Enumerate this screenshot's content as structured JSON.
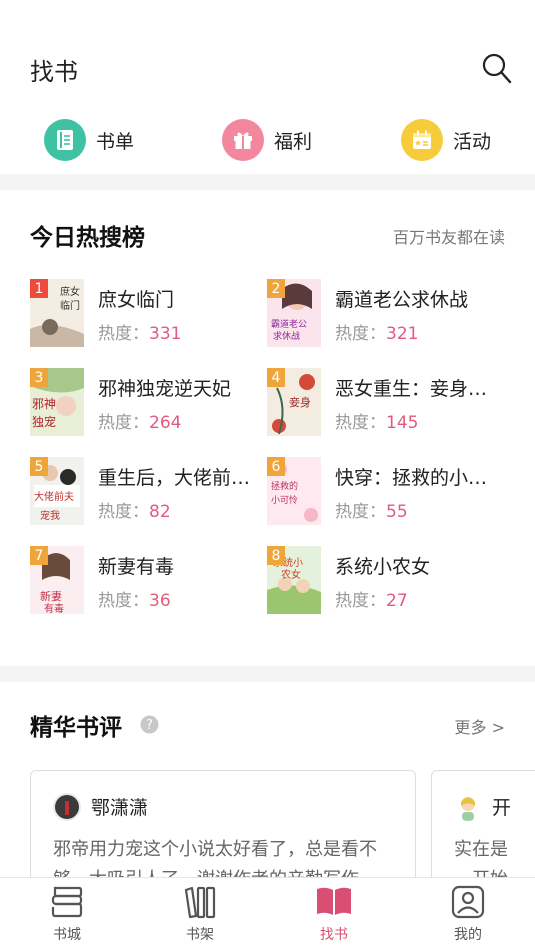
{
  "header": {
    "title": "找书",
    "search_icon": "search-icon"
  },
  "quick_entries": [
    {
      "label": "书单",
      "icon": "booklist-icon",
      "color": "#3fc2a4"
    },
    {
      "label": "福利",
      "icon": "gift-icon",
      "color": "#f3879d"
    },
    {
      "label": "活动",
      "icon": "calendar-icon",
      "color": "#f7cc3a"
    }
  ],
  "hot_search": {
    "title": "今日热搜榜",
    "subtitle": "百万书友都在读",
    "heat_label": "热度：",
    "items": [
      {
        "rank": "1",
        "name": "庶女临门",
        "heat": "331",
        "cover_text": "庶女临门"
      },
      {
        "rank": "2",
        "name": "霸道老公求休战",
        "heat": "321",
        "cover_text": "霸道老公求休战"
      },
      {
        "rank": "3",
        "name": "邪神独宠逆天妃",
        "heat": "264",
        "cover_text": "邪神独宠"
      },
      {
        "rank": "4",
        "name": "恶女重生：妾身…",
        "heat": "145",
        "cover_text": "妾身"
      },
      {
        "rank": "5",
        "name": "重生后，大佬前…",
        "heat": "82",
        "cover_text": "大佬前夫"
      },
      {
        "rank": "6",
        "name": "快穿：拯救的小…",
        "heat": "55",
        "cover_text": "拯救的小可怜"
      },
      {
        "rank": "7",
        "name": "新妻有毒",
        "heat": "36",
        "cover_text": "新妻有毒"
      },
      {
        "rank": "8",
        "name": "系统小农女",
        "heat": "27",
        "cover_text": "系统小农女"
      }
    ],
    "colors": {
      "badge_top": "#f04a3a",
      "badge_other": "#f0a53a",
      "heat": "#e25b7e"
    }
  },
  "reviews": {
    "title": "精华书评",
    "help_icon": "question-icon",
    "more": "更多 >",
    "cards": [
      {
        "user": "鄂潇潇",
        "text": "邪帝用力宠这个小说太好看了，总是看不够，太吸引人了，谢谢作者的辛勤写作"
      },
      {
        "user": "开",
        "text": "实在是一开始"
      }
    ]
  },
  "tabbar": {
    "active_color": "#d94f74",
    "tabs": [
      {
        "label": "书城",
        "icon": "bookstore-icon"
      },
      {
        "label": "书架",
        "icon": "bookshelf-icon"
      },
      {
        "label": "找书",
        "icon": "open-book-icon"
      },
      {
        "label": "我的",
        "icon": "profile-icon"
      }
    ]
  }
}
